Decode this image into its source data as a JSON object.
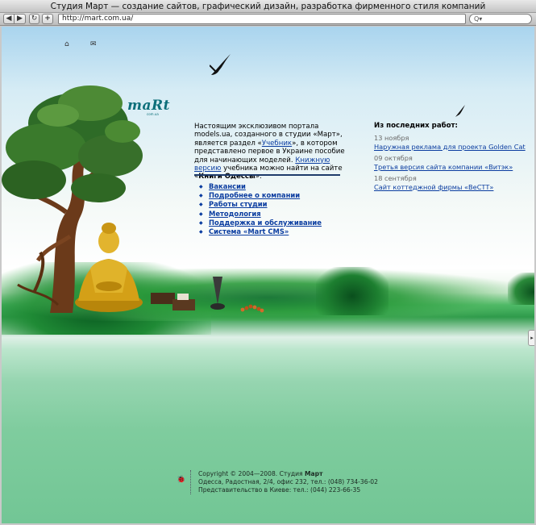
{
  "window": {
    "title": "Студия Март — создание сайтов, графический дизайн, разработка фирменного стиля компаний"
  },
  "toolbar": {
    "back_symbol": "◀",
    "forward_symbol": "▶",
    "reload_symbol": "↻",
    "add_symbol": "+",
    "url": "http://mart.com.ua/",
    "search_symbol": "Q▾"
  },
  "top_icons": {
    "home": "⌂",
    "mail": "✉"
  },
  "logo": {
    "text": "maRt",
    "sub": "com.ua"
  },
  "intro": {
    "part1": "Настоящим эксклюзивом портала models.ua, созданного в студии «Март», является раздел «",
    "link1": "Учебник",
    "part2": "», в котором представлено первое в Украине пособие для начинающих моделей. ",
    "link2": "Книжную версию",
    "part3": " учебника можно найти на сайте «",
    "bold": "Книги Одессы",
    "part4": "»."
  },
  "menu": [
    {
      "label": "Вакансии"
    },
    {
      "label": "Подробнее о компании"
    },
    {
      "label": "Работы студии"
    },
    {
      "label": "Методология"
    },
    {
      "label": "Поддержка и обслуживание"
    },
    {
      "label": "Система «Mart CMS»"
    }
  ],
  "news": {
    "title": "Из последних работ:",
    "items": [
      {
        "date": "13 ноября",
        "link": "Наружная реклама для проекта Golden Cat"
      },
      {
        "date": "09 октября",
        "link": "Третья версия сайта компании «Витэк»"
      },
      {
        "date": "18 сентября",
        "link": "Сайт коттеджной фирмы «ВеСТТ»"
      }
    ]
  },
  "footer": {
    "line1_prefix": "Copyright © 2004—2008. Студия ",
    "line1_brand": "Март",
    "line2": "Одесса, Радостная, 2/4, офис 232, тел.: (048) 734-36-02",
    "line3": "Представительство в Киеве: тел.: (044) 223-66-35",
    "icon": "🐞"
  },
  "side_tab": {
    "symbol": "▸"
  },
  "colors": {
    "link": "#0b3da0",
    "logo": "#0d6f7a",
    "grass": "#2f9b4b",
    "sky": "#a9d4ee"
  }
}
